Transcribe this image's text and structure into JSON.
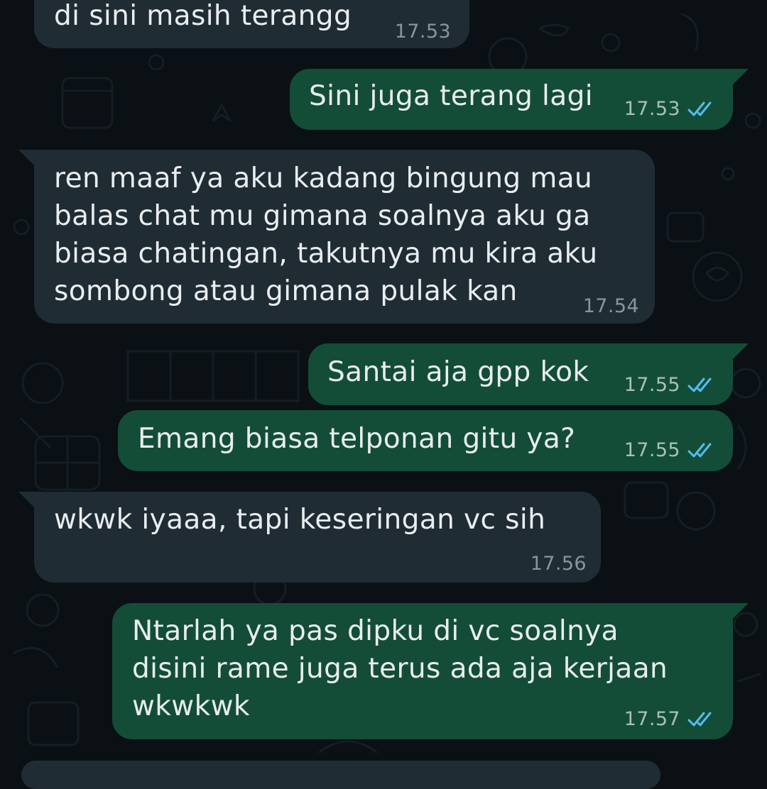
{
  "colors": {
    "background": "#0b1014",
    "incoming_bubble": "#1f2c34",
    "outgoing_bubble": "#134d37",
    "text": "#e9edef",
    "read_tick": "#53bdeb"
  },
  "messages": [
    {
      "direction": "incoming",
      "text": "di sini masih terangg",
      "time": "17.53"
    },
    {
      "direction": "outgoing",
      "text": "Sini juga terang lagi",
      "time": "17.53",
      "status_icon": "read-double-check-icon"
    },
    {
      "direction": "incoming",
      "text": "ren maaf ya aku kadang bingung mau\nbalas chat mu gimana soalnya aku ga\nbiasa chatingan, takutnya mu kira aku\nsombong atau gimana pulak kan",
      "time": "17.54"
    },
    {
      "direction": "outgoing",
      "text": "Santai aja gpp kok",
      "time": "17.55",
      "status_icon": "read-double-check-icon"
    },
    {
      "direction": "outgoing",
      "text": "Emang biasa telponan gitu ya?",
      "time": "17.55",
      "status_icon": "read-double-check-icon"
    },
    {
      "direction": "incoming",
      "text": "wkwk iyaaa, tapi keseringan vc sih",
      "time": "17.56"
    },
    {
      "direction": "outgoing",
      "text": "Ntarlah ya pas dipku di vc soalnya\ndisini rame juga terus ada aja kerjaan\nwkwkwk",
      "time": "17.57",
      "status_icon": "read-double-check-icon"
    }
  ]
}
